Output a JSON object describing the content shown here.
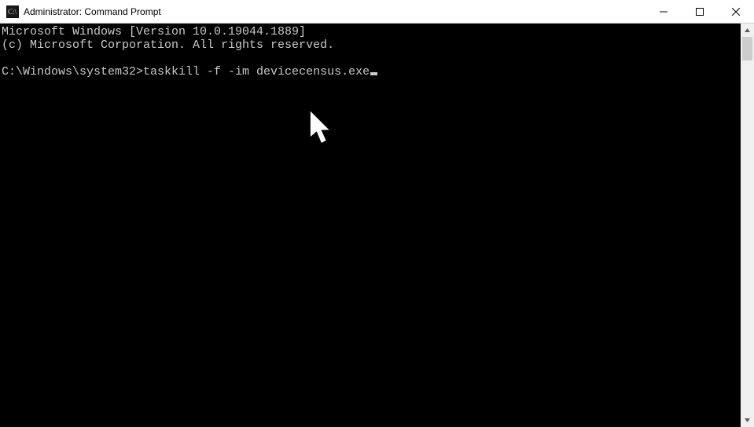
{
  "window": {
    "title": "Administrator: Command Prompt"
  },
  "terminal": {
    "line1": "Microsoft Windows [Version 10.0.19044.1889]",
    "line2": "(c) Microsoft Corporation. All rights reserved.",
    "blank": "",
    "prompt": "C:\\Windows\\system32>",
    "command": "taskkill -f -im devicecensus.exe"
  }
}
